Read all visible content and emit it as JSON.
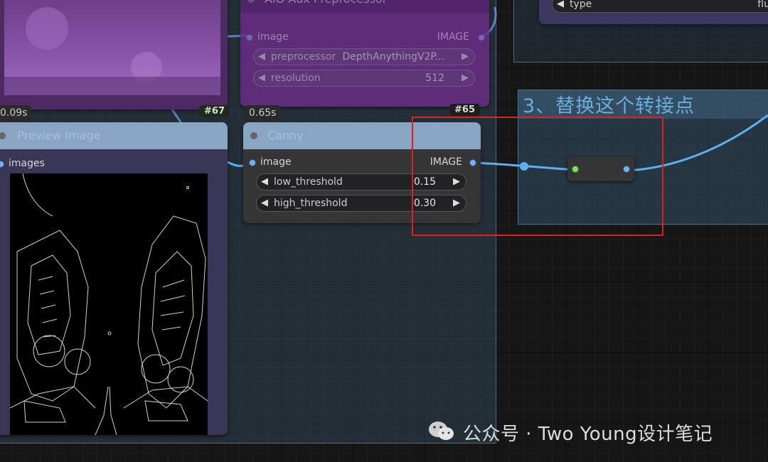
{
  "groups": {
    "adapter_title": "3、替换这个转接点"
  },
  "nodes": {
    "aux": {
      "title": "AIO Aux Preprocessor",
      "input_label": "image",
      "output_label": "IMAGE",
      "widgets": [
        {
          "name": "preprocessor",
          "value": "DepthAnythingV2P..."
        },
        {
          "name": "resolution",
          "value": "512"
        }
      ]
    },
    "preview": {
      "title": "Preview Image",
      "input_label": "images",
      "time": "0.09s",
      "badge": "#67"
    },
    "canny": {
      "title": "Canny",
      "input_label": "image",
      "output_label": "IMAGE",
      "time": "0.65s",
      "badge": "#65",
      "widgets": [
        {
          "name": "low_threshold",
          "value": "0.15"
        },
        {
          "name": "high_threshold",
          "value": "0.30"
        }
      ]
    },
    "top_right": {
      "widget_name": "type",
      "widget_value": "flu"
    }
  },
  "watermark": {
    "text": "公众号 · Two Young设计笔记"
  },
  "colors": {
    "link": "#5ab0f0",
    "reroute_input": "#7ee05a",
    "highlight": "#e02020",
    "group_title": "#6aaedc"
  }
}
